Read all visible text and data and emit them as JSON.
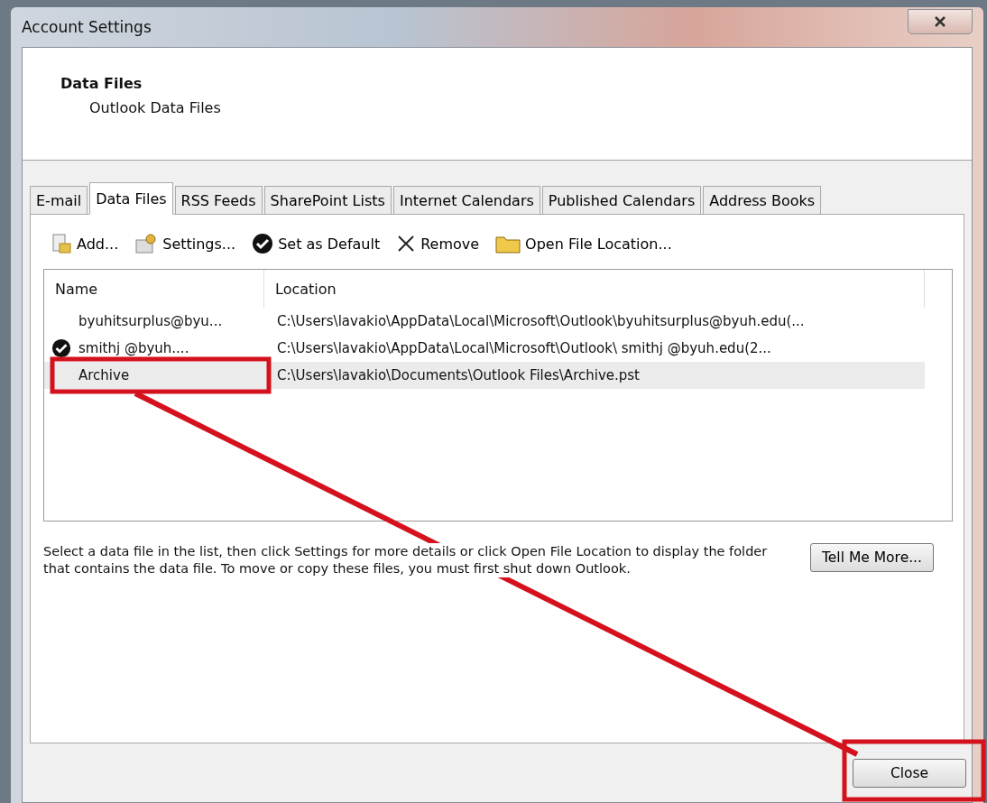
{
  "window": {
    "title": "Account Settings"
  },
  "header": {
    "title": "Data Files",
    "subtitle": "Outlook Data Files"
  },
  "tabs": [
    {
      "label": "E-mail",
      "selected": false
    },
    {
      "label": "Data Files",
      "selected": true
    },
    {
      "label": "RSS Feeds",
      "selected": false
    },
    {
      "label": "SharePoint Lists",
      "selected": false
    },
    {
      "label": "Internet Calendars",
      "selected": false
    },
    {
      "label": "Published Calendars",
      "selected": false
    },
    {
      "label": "Address Books",
      "selected": false
    }
  ],
  "toolbar": [
    {
      "kind": "add",
      "label": "Add..."
    },
    {
      "kind": "settings",
      "label": "Settings..."
    },
    {
      "kind": "default",
      "label": "Set as Default"
    },
    {
      "kind": "remove",
      "label": "Remove"
    },
    {
      "kind": "folder",
      "label": "Open File Location..."
    }
  ],
  "table": {
    "columns": [
      "Name",
      "Location"
    ],
    "rows": [
      {
        "name": "byuhitsurplus@byu...",
        "location": "C:\\Users\\lavakio\\AppData\\Local\\Microsoft\\Outlook\\byuhitsurplus@byuh.edu(...",
        "default": false,
        "selected": false
      },
      {
        "name": "smithj @byuh....",
        "location": "C:\\Users\\lavakio\\AppData\\Local\\Microsoft\\Outlook\\ smithj @byuh.edu(2...",
        "default": true,
        "selected": false
      },
      {
        "name": "Archive",
        "location": "C:\\Users\\lavakio\\Documents\\Outlook Files\\Archive.pst",
        "default": false,
        "selected": true
      }
    ]
  },
  "help_text": "Select a data file in the list, then click Settings for more details or click Open File Location to display the folder that contains the data file. To move or copy these files, you must first shut down Outlook.",
  "tell_me_more": "Tell Me More...",
  "close_button": "Close"
}
